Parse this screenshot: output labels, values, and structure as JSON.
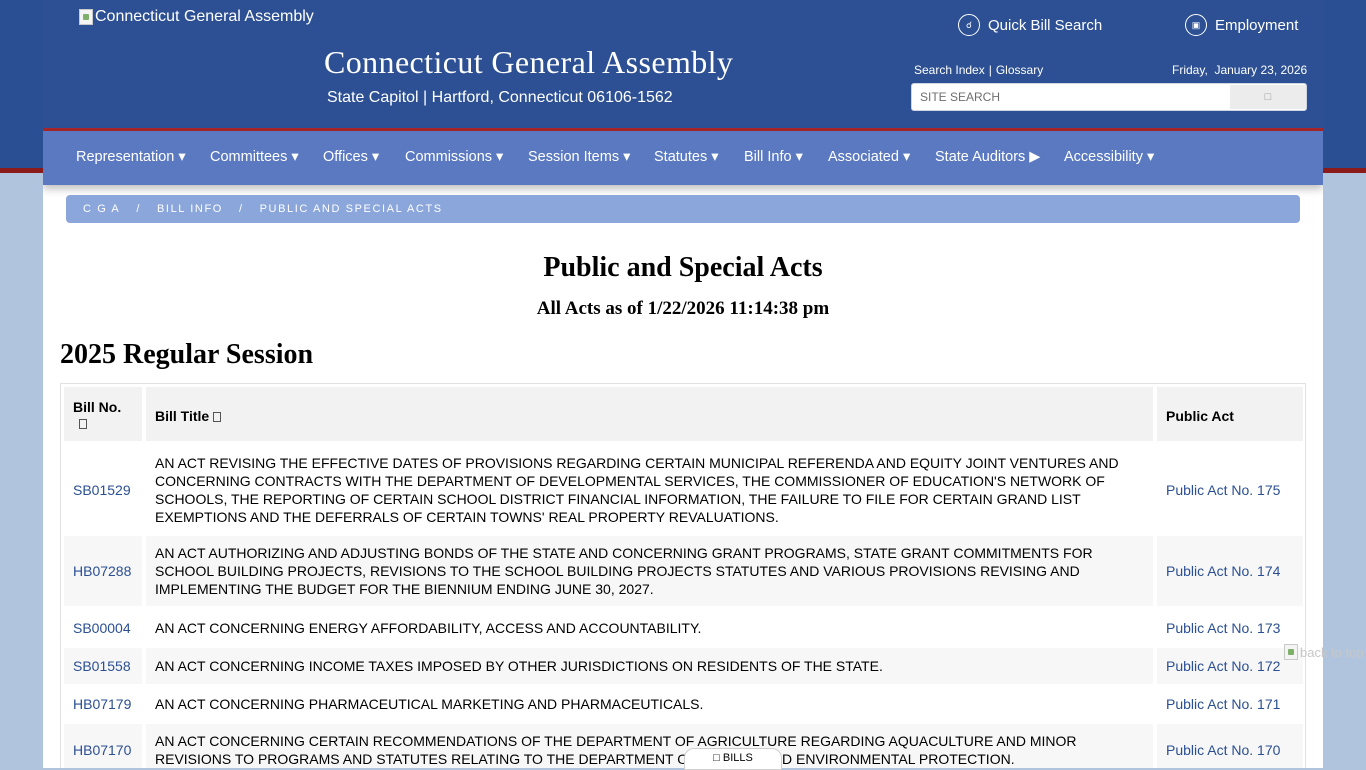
{
  "header": {
    "logo_alt": "Connecticut General Assembly",
    "title": "Connecticut General Assembly",
    "subtitle": "State Capitol | Hartford, Connecticut 06106-1562",
    "top_links": [
      {
        "label": "Quick Bill Search",
        "icon": "search-icon"
      },
      {
        "label": "Employment",
        "icon": "briefcase-icon"
      }
    ],
    "search_links": [
      "Search Index",
      "Glossary"
    ],
    "date": "Friday,  January 23, 2026",
    "search_placeholder": "SITE SEARCH"
  },
  "nav": [
    "Representation ▾",
    "Committees ▾",
    "Offices ▾",
    "Commissions ▾",
    "Session Items ▾",
    "Statutes ▾",
    "Bill Info ▾",
    "Associated ▾",
    "State Auditors ▶",
    "Accessibility ▾"
  ],
  "breadcrumb": [
    "C G A",
    "BILL INFO",
    "PUBLIC AND SPECIAL ACTS"
  ],
  "page": {
    "title": "Public and Special Acts",
    "subtitle": "All Acts as of 1/22/2026 11:14:38 pm",
    "session": "2025 Regular Session"
  },
  "table": {
    "headers": [
      "Bill No.",
      "Bill Title",
      "Public Act"
    ],
    "rows": [
      {
        "bill": "SB01529",
        "title": "AN ACT REVISING THE EFFECTIVE DATES OF PROVISIONS REGARDING CERTAIN MUNICIPAL REFERENDA AND EQUITY JOINT VENTURES AND CONCERNING CONTRACTS WITH THE DEPARTMENT OF DEVELOPMENTAL SERVICES, THE COMMISSIONER OF EDUCATION'S NETWORK OF SCHOOLS, THE REPORTING OF CERTAIN SCHOOL DISTRICT FINANCIAL INFORMATION, THE FAILURE TO FILE FOR CERTAIN GRAND LIST EXEMPTIONS AND THE DEFERRALS OF CERTAIN TOWNS' REAL PROPERTY REVALUATIONS.",
        "act": "Public Act No. 175"
      },
      {
        "bill": "HB07288",
        "title": "AN ACT AUTHORIZING AND ADJUSTING BONDS OF THE STATE AND CONCERNING GRANT PROGRAMS, STATE GRANT COMMITMENTS FOR SCHOOL BUILDING PROJECTS, REVISIONS TO THE SCHOOL BUILDING PROJECTS STATUTES AND VARIOUS PROVISIONS REVISING AND IMPLEMENTING THE BUDGET FOR THE BIENNIUM ENDING JUNE 30, 2027.",
        "act": "Public Act No. 174"
      },
      {
        "bill": "SB00004",
        "title": "AN ACT CONCERNING ENERGY AFFORDABILITY, ACCESS AND ACCOUNTABILITY.",
        "act": "Public Act No. 173"
      },
      {
        "bill": "SB01558",
        "title": "AN ACT CONCERNING INCOME TAXES IMPOSED BY OTHER JURISDICTIONS ON RESIDENTS OF THE STATE.",
        "act": "Public Act No. 172"
      },
      {
        "bill": "HB07179",
        "title": "AN ACT CONCERNING PHARMACEUTICAL MARKETING AND PHARMACEUTICALS.",
        "act": "Public Act No. 171"
      },
      {
        "bill": "HB07170",
        "title": "AN ACT CONCERNING CERTAIN RECOMMENDATIONS OF THE DEPARTMENT OF AGRICULTURE REGARDING AQUACULTURE AND MINOR REVISIONS TO PROGRAMS AND STATUTES RELATING TO THE DEPARTMENT OF ENERGY AND ENVIRONMENTAL PROTECTION.",
        "act": "Public Act No. 170"
      }
    ]
  },
  "back_to_top_alt": "back to top",
  "bills_tab": "BILLS"
}
